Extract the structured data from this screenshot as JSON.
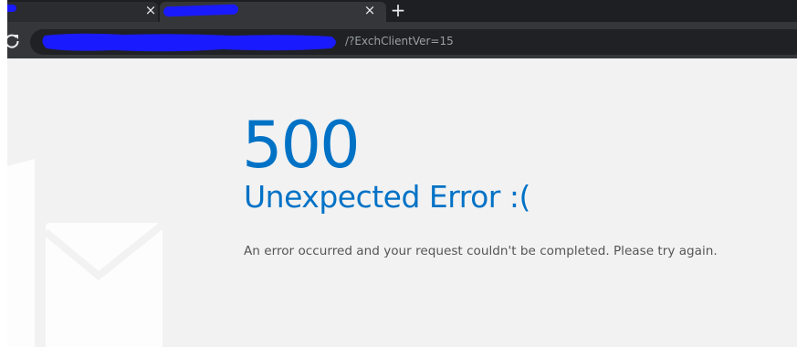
{
  "browser": {
    "tabs": [
      {
        "close_icon": "×"
      },
      {
        "close_icon": "×"
      }
    ],
    "new_tab_icon": "+",
    "address_bar": {
      "visible_url_suffix": "/?ExchClientVer=15"
    }
  },
  "page": {
    "error_code": "500",
    "error_title": "Unexpected Error :(",
    "error_message": "An error occurred and your request couldn't be completed. Please try again."
  },
  "colors": {
    "accent": "#0072c6",
    "page_background": "#f2f2f2",
    "tabstrip": "#1e1f22",
    "toolbar": "#35363a",
    "redaction": "#1a1aff"
  },
  "icons": {
    "reload": "reload-icon",
    "close": "close-icon",
    "new_tab": "plus-icon",
    "background_logo": "outlook-mail-logo"
  }
}
